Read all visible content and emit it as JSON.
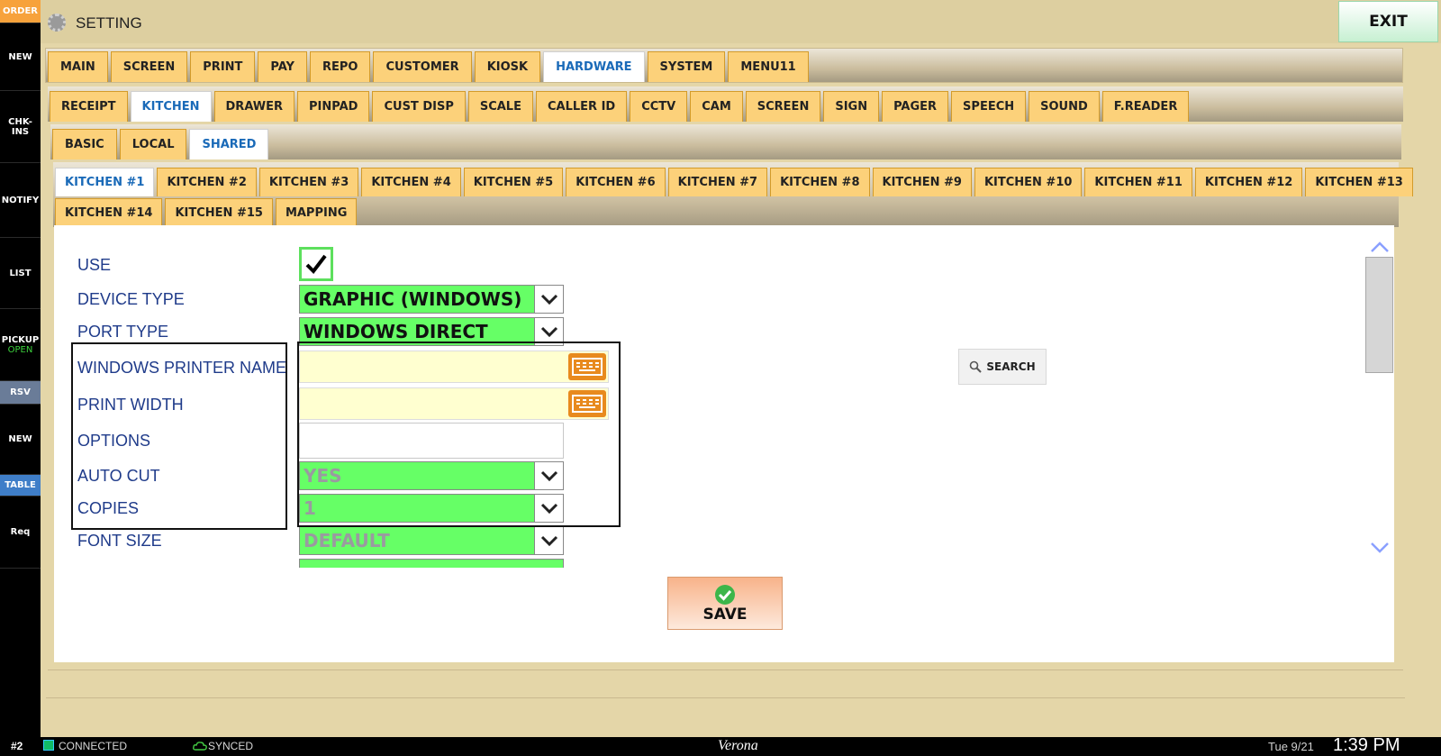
{
  "left_nav": [
    {
      "label": "ORDER",
      "sub": ""
    },
    {
      "label": "NEW",
      "sub": ""
    },
    {
      "label": "CHK-INS",
      "sub": ""
    },
    {
      "label": "NOTIFY",
      "sub": ""
    },
    {
      "label": "LIST",
      "sub": ""
    },
    {
      "label": "PICKUP",
      "sub": "OPEN"
    },
    {
      "label": "RSV",
      "sub": ""
    },
    {
      "label": "NEW",
      "sub": ""
    },
    {
      "label": "TABLE",
      "sub": ""
    },
    {
      "label": "Req",
      "sub": ""
    }
  ],
  "header": {
    "title": "SETTING",
    "exit_label": "EXIT"
  },
  "tabs_main": [
    "MAIN",
    "SCREEN",
    "PRINT",
    "PAY",
    "REPO",
    "CUSTOMER",
    "KIOSK",
    "HARDWARE",
    "SYSTEM",
    "MENU11"
  ],
  "tabs_hardware": [
    "RECEIPT",
    "KITCHEN",
    "DRAWER",
    "PINPAD",
    "CUST DISP",
    "SCALE",
    "CALLER ID",
    "CCTV",
    "CAM",
    "SCREEN",
    "SIGN",
    "PAGER",
    "SPEECH",
    "SOUND",
    "F.READER"
  ],
  "tabs_kitchen": [
    "BASIC",
    "LOCAL",
    "SHARED"
  ],
  "tabs_printers_row1": [
    "KITCHEN #1",
    "KITCHEN #2",
    "KITCHEN #3",
    "KITCHEN #4",
    "KITCHEN #5",
    "KITCHEN #6",
    "KITCHEN #7",
    "KITCHEN #8",
    "KITCHEN #9",
    "KITCHEN #10",
    "KITCHEN #11",
    "KITCHEN #12",
    "KITCHEN #13"
  ],
  "tabs_printers_row2": [
    "KITCHEN #14",
    "KITCHEN #15",
    "MAPPING"
  ],
  "form": {
    "use_label": "USE",
    "use_checked": true,
    "device_type_label": "DEVICE TYPE",
    "device_type_value": "GRAPHIC (WINDOWS)",
    "port_type_label": "PORT TYPE",
    "port_type_value": "WINDOWS DIRECT",
    "printer_name_label": "WINDOWS PRINTER NAME",
    "printer_name_value": "",
    "print_width_label": "PRINT WIDTH",
    "print_width_value": "",
    "options_label": "OPTIONS",
    "options_value": "",
    "auto_cut_label": "AUTO CUT",
    "auto_cut_value": "YES",
    "copies_label": "COPIES",
    "copies_value": "1",
    "font_size_label": "FONT SIZE",
    "font_size_value": "DEFAULT",
    "search_label": "SEARCH",
    "save_label": "SAVE"
  },
  "status": {
    "station": "#2",
    "connection": "CONNECTED",
    "sync": "SYNCED",
    "store": "Verona",
    "date": "Tue 9/21",
    "time": "1:39 PM"
  },
  "colors": {
    "tab": "#fcd17a",
    "active_tab_text": "#1a6ab8",
    "dropdown": "#66ff66",
    "label": "#1f3b8a"
  }
}
